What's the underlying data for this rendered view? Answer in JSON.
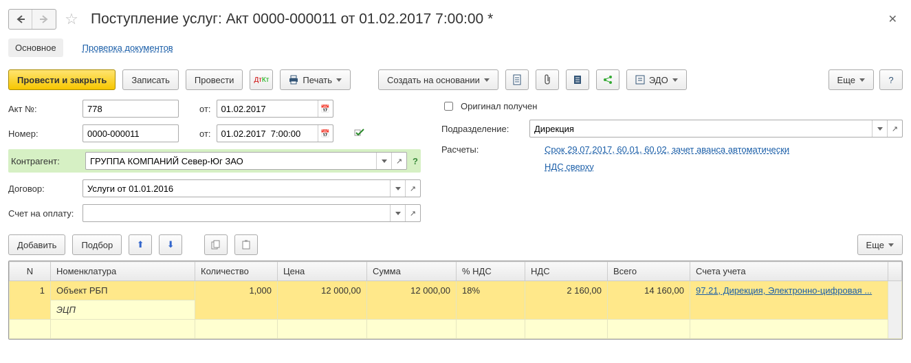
{
  "title": "Поступление услуг: Акт 0000-000011 от 01.02.2017 7:00:00 *",
  "tabs": {
    "main": "Основное",
    "check": "Проверка документов"
  },
  "toolbar": {
    "post_close": "Провести и закрыть",
    "save": "Записать",
    "post": "Провести",
    "print": "Печать",
    "create_based": "Создать на основании",
    "edo": "ЭДО",
    "more": "Еще",
    "help": "?"
  },
  "fields": {
    "akt_no_label": "Акт №:",
    "akt_no": "778",
    "from": "от:",
    "akt_date": "01.02.2017",
    "number_label": "Номер:",
    "number": "0000-000011",
    "number_date": "01.02.2017  7:00:00",
    "original_label": "Оригинал получен",
    "division_label": "Подразделение:",
    "division": "Дирекция",
    "counterparty_label": "Контрагент:",
    "counterparty": "ГРУППА КОМПАНИЙ Север-Юг ЗАО",
    "calc_label": "Расчеты:",
    "calc_link": "Срок 29.07.2017, 60.01, 60.02, зачет аванса автоматически",
    "contract_label": "Договор:",
    "contract": "Услуги от 01.01.2016",
    "vat_link": "НДС сверху",
    "invoice_label": "Счет на оплату:",
    "add": "Добавить",
    "select": "Подбор",
    "more": "Еще"
  },
  "table": {
    "headers": {
      "n": "N",
      "item": "Номенклатура",
      "qty": "Количество",
      "price": "Цена",
      "sum": "Сумма",
      "vat_pct": "% НДС",
      "vat": "НДС",
      "total": "Всего",
      "accounts": "Счета учета"
    },
    "row": {
      "n": "1",
      "item": "Объект РБП",
      "item2": "ЭЦП",
      "qty": "1,000",
      "price": "12 000,00",
      "sum": "12 000,00",
      "vat_pct": "18%",
      "vat": "2 160,00",
      "total": "14 160,00",
      "account": "97.21, Дирекция, Электронно-цифровая ..."
    }
  }
}
